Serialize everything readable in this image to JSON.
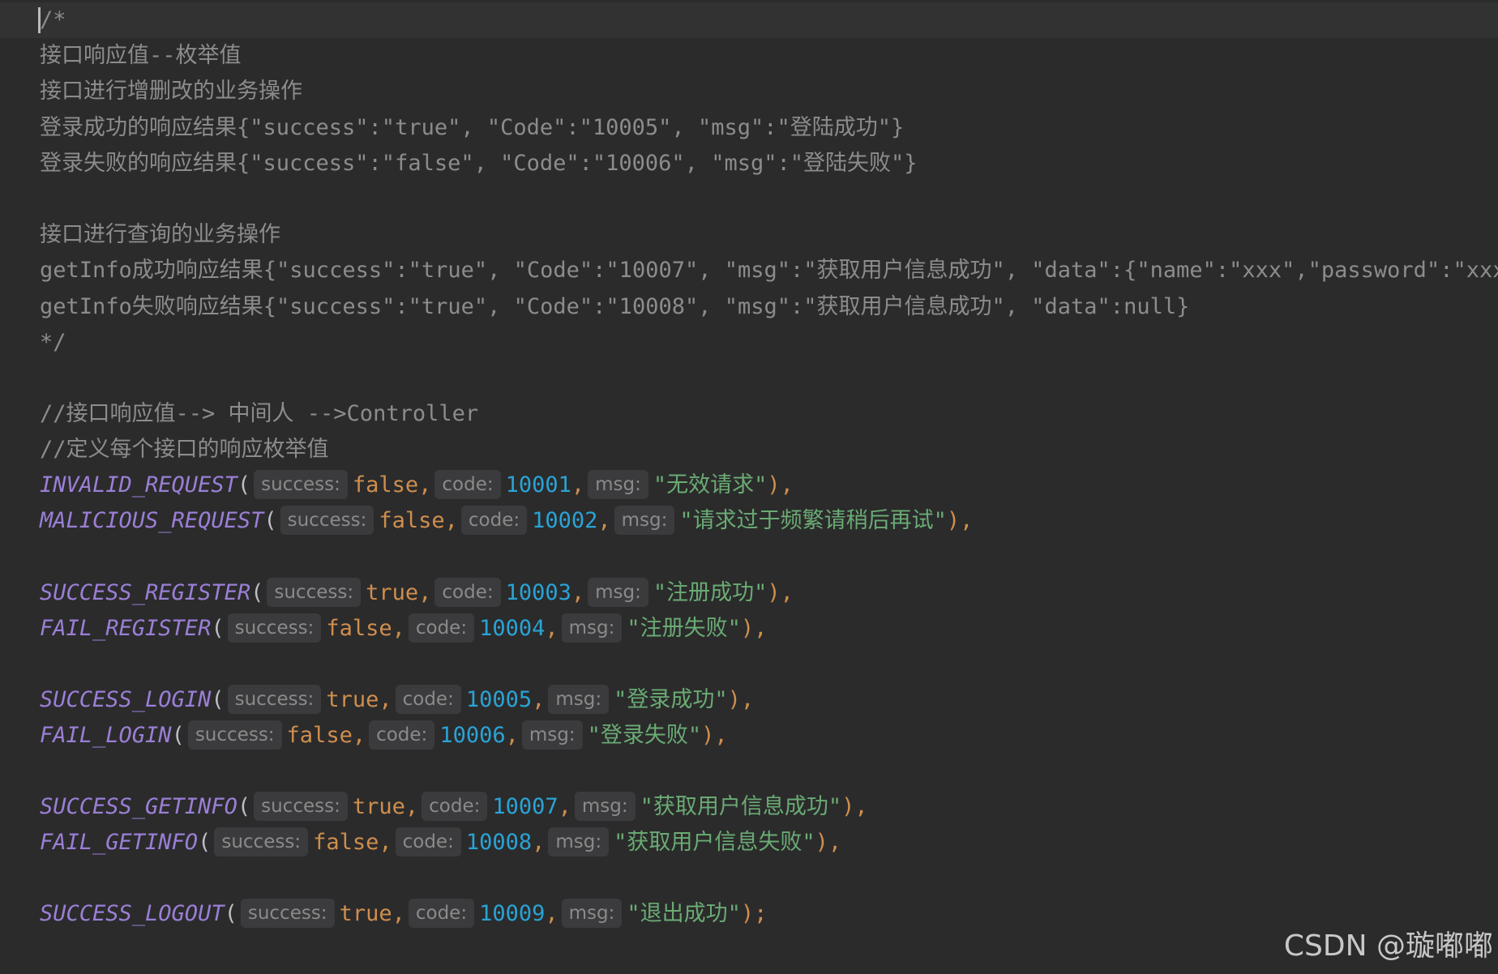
{
  "block_comment": {
    "open": "/*",
    "lines": [
      "接口响应值--枚举值",
      "接口进行增删改的业务操作",
      "登录成功的响应结果{\"success\":\"true\", \"Code\":\"10005\", \"msg\":\"登陆成功\"}",
      "登录失败的响应结果{\"success\":\"false\", \"Code\":\"10006\", \"msg\":\"登陆失败\"}",
      "",
      "接口进行查询的业务操作",
      "getInfo成功响应结果{\"success\":\"true\", \"Code\":\"10007\", \"msg\":\"获取用户信息成功\", \"data\":{\"name\":\"xxx\",\"password\":\"xxx\"}}",
      "getInfo失败响应结果{\"success\":\"true\", \"Code\":\"10008\", \"msg\":\"获取用户信息成功\", \"data\":null}"
    ],
    "close": "*/"
  },
  "line_comments": [
    "//接口响应值--> 中间人 -->Controller",
    "//定义每个接口的响应枚举值"
  ],
  "hints": {
    "success": "success:",
    "code": "code:",
    "msg": "msg:"
  },
  "enums": [
    {
      "name": "INVALID_REQUEST",
      "success": "false",
      "code": "10001",
      "msg": "\"无效请求\"",
      "end": "),"
    },
    {
      "name": "MALICIOUS_REQUEST",
      "success": "false",
      "code": "10002",
      "msg": "\"请求过于频繁请稍后再试\"",
      "end": "),"
    },
    {
      "name": "SUCCESS_REGISTER",
      "success": "true",
      "code": "10003",
      "msg": "\"注册成功\"",
      "end": "),"
    },
    {
      "name": "FAIL_REGISTER",
      "success": "false",
      "code": "10004",
      "msg": "\"注册失败\"",
      "end": "),"
    },
    {
      "name": "SUCCESS_LOGIN",
      "success": "true",
      "code": "10005",
      "msg": "\"登录成功\"",
      "end": "),"
    },
    {
      "name": "FAIL_LOGIN",
      "success": "false",
      "code": "10006",
      "msg": "\"登录失败\"",
      "end": "),"
    },
    {
      "name": "SUCCESS_GETINFO",
      "success": "true",
      "code": "10007",
      "msg": "\"获取用户信息成功\"",
      "end": "),"
    },
    {
      "name": "FAIL_GETINFO",
      "success": "false",
      "code": "10008",
      "msg": "\"获取用户信息失败\"",
      "end": "),"
    },
    {
      "name": "SUCCESS_LOGOUT",
      "success": "true",
      "code": "10009",
      "msg": "\"退出成功\"",
      "end": ");"
    }
  ],
  "watermark": "CSDN @璇嘟嘟",
  "colors": {
    "background": "#2b2b2c",
    "comment": "#8c8c8c",
    "enum_name": "#9b7fd6",
    "keyword": "#cf8e4d",
    "number": "#2aa3d4",
    "string": "#6aab73"
  }
}
